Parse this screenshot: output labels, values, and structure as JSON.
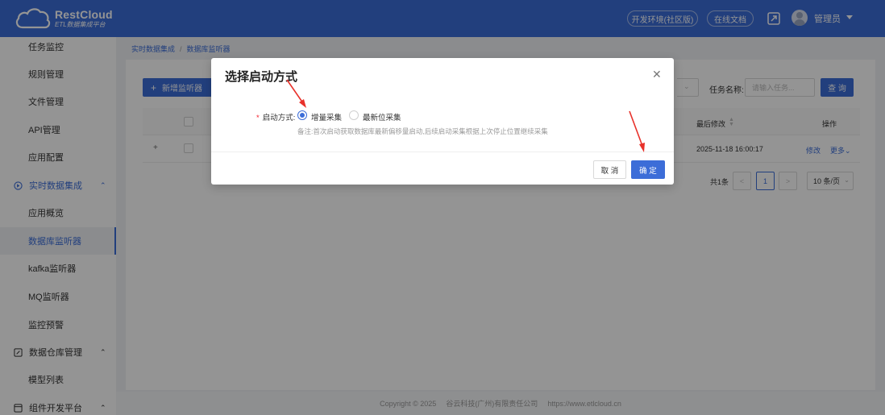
{
  "header": {
    "logo_title": "RestCloud",
    "logo_subtitle": "ETL数据集成平台",
    "env_button": "开发环境(社区版)",
    "docs_button": "在线文档",
    "username": "管理员",
    "brand_color": "#3c6dd8"
  },
  "sidebar": {
    "items": [
      {
        "label": "任务监控"
      },
      {
        "label": "规则管理"
      },
      {
        "label": "文件管理"
      },
      {
        "label": "API管理"
      },
      {
        "label": "应用配置"
      },
      {
        "label": "实时数据集成",
        "icon": "realtime-icon",
        "group": true
      },
      {
        "label": "应用概览"
      },
      {
        "label": "数据库监听器",
        "active": true
      },
      {
        "label": "kafka监听器"
      },
      {
        "label": "MQ监听器"
      },
      {
        "label": "监控预警"
      },
      {
        "label": "数据仓库管理",
        "icon": "warehouse-icon",
        "group": true
      },
      {
        "label": "模型列表"
      },
      {
        "label": "组件开发平台",
        "icon": "component-icon",
        "group": true
      }
    ]
  },
  "breadcrumb": [
    "实时数据集成",
    "数据库监听器"
  ],
  "toolbar": {
    "add_button": "新增监听器",
    "task_name_label": "任务名称:",
    "task_name_placeholder": "请输入任务...",
    "query_button": "查 询"
  },
  "table": {
    "headers": {
      "last_modified": "最后修改",
      "action": "操作"
    },
    "rows": [
      {
        "last_modified": "2025-11-18 16:00:17",
        "edit": "修改",
        "more": "更多"
      }
    ]
  },
  "pagination": {
    "total": "共1条",
    "current_page": "1",
    "page_size": "10 条/页"
  },
  "footer": {
    "copyright": "Copyright © 2025",
    "company": "谷云科技(广州)有限责任公司",
    "url": "https://www.etlcloud.cn"
  },
  "modal": {
    "title": "选择启动方式",
    "field_label": "启动方式:",
    "options": [
      {
        "label": "增量采集",
        "checked": true
      },
      {
        "label": "最新位采集",
        "checked": false
      }
    ],
    "note": "备注:首次启动获取数据库最新偏移量启动,后续启动采集根据上次停止位置继续采集",
    "cancel": "取 消",
    "confirm": "确 定"
  },
  "annotations": {
    "arrow_color": "#e8312a"
  }
}
